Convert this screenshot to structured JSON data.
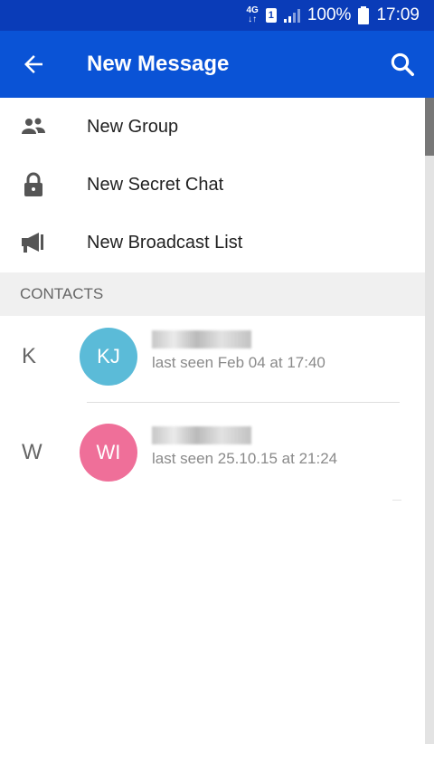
{
  "status_bar": {
    "network": "4G",
    "sim": "1",
    "battery": "100%",
    "time": "17:09"
  },
  "app_bar": {
    "title": "New Message",
    "back_icon": "arrow-left-icon",
    "search_icon": "search-icon"
  },
  "menu": [
    {
      "label": "New Group",
      "icon": "group-icon"
    },
    {
      "label": "New Secret Chat",
      "icon": "lock-icon"
    },
    {
      "label": "New Broadcast List",
      "icon": "megaphone-icon"
    }
  ],
  "section_header": "CONTACTS",
  "contacts": [
    {
      "letter": "K",
      "initials": "KJ",
      "status": "last seen Feb 04 at 17:40",
      "color": "#5bbbd8"
    },
    {
      "letter": "W",
      "initials": "WI",
      "status": "last seen 25.10.15 at 21:24",
      "color": "#ef6f99"
    }
  ],
  "colors": {
    "status_bar": "#0a3cb8",
    "app_bar": "#0a53d6"
  }
}
